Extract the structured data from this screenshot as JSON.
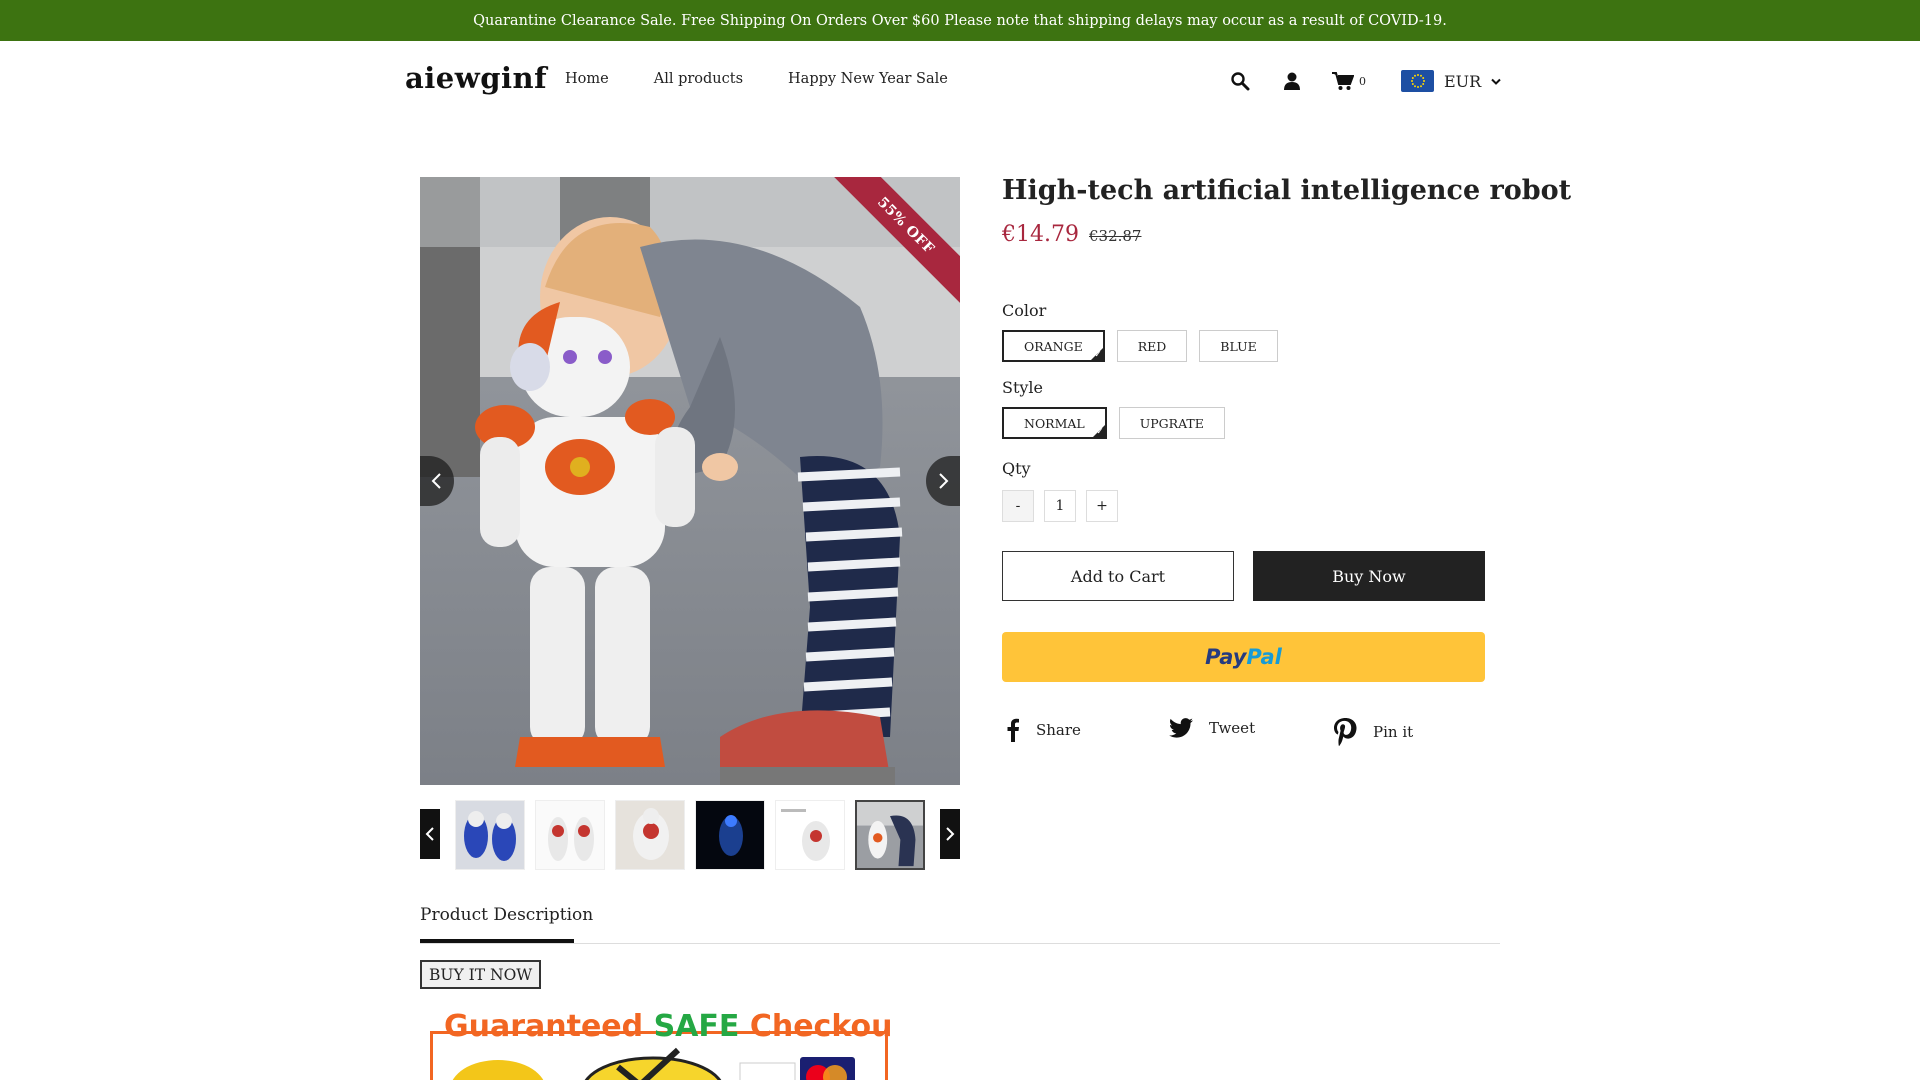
{
  "announcement": "Quarantine Clearance Sale. Free Shipping On Orders Over $60 Please note that shipping delays may occur as a result of COVID-19.",
  "header": {
    "logo": "aiewginf",
    "nav": [
      "Home",
      "All products",
      "Happy New Year Sale"
    ],
    "cart_count": "0",
    "currency": "EUR"
  },
  "product": {
    "badge": "55% OFF",
    "title": "High-tech artificial intelligence robot",
    "price": "€14.79",
    "compare_price": "€32.87",
    "options": [
      {
        "label": "Color",
        "values": [
          "ORANGE",
          "RED",
          "BLUE"
        ],
        "selected": 0
      },
      {
        "label": "Style",
        "values": [
          "NORMAL",
          "UPGRATE"
        ],
        "selected": 0
      }
    ],
    "qty_label": "Qty",
    "qty_minus": "-",
    "qty_value": "1",
    "qty_plus": "+",
    "add_to_cart": "Add to Cart",
    "buy_now": "Buy Now",
    "paypal_a": "Pay",
    "paypal_b": "Pal",
    "share": [
      {
        "label": "Share",
        "icon": "facebook-icon"
      },
      {
        "label": "Tweet",
        "icon": "twitter-icon"
      },
      {
        "label": "Pin it",
        "icon": "pinterest-icon"
      }
    ],
    "thumbnails": 6,
    "active_thumbnail": 5
  },
  "tabs": {
    "description": "Product Description"
  },
  "description": {
    "button": "BUY IT NOW",
    "badge_part1": "Guaranteed ",
    "badge_part2": "SAFE",
    "badge_part3": " Checkout"
  },
  "colors": {
    "announcement_bg": "#3d7311",
    "price": "#a8273e",
    "paypal": "#ffc439"
  }
}
